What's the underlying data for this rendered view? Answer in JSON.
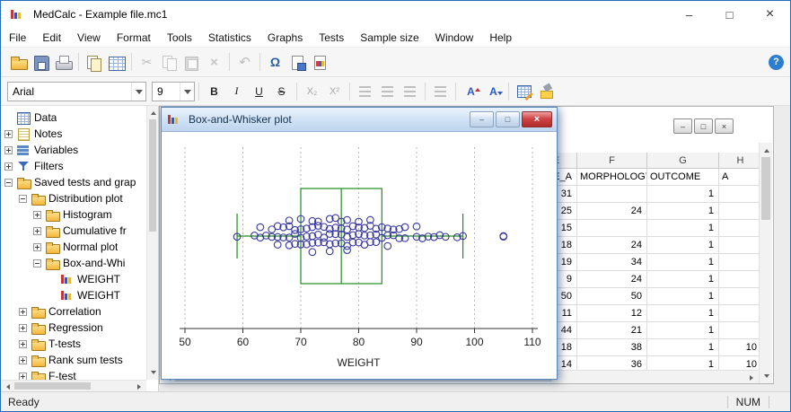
{
  "titlebar": {
    "title": "MedCalc - Example file.mc1",
    "buttons": {
      "minimize": "–",
      "maximize": "□",
      "close": "×"
    }
  },
  "menu": {
    "items": [
      "File",
      "Edit",
      "View",
      "Format",
      "Tools",
      "Statistics",
      "Graphs",
      "Tests",
      "Sample size",
      "Window",
      "Help"
    ]
  },
  "toolbar_main": {
    "icons": [
      "open-folder",
      "save",
      "print",
      "|",
      "copy-page",
      "table",
      "|",
      "cut",
      "copy",
      "paste",
      "delete",
      "|",
      "undo",
      "|",
      "omega",
      "insert-sheet",
      "chart-sheet"
    ],
    "disabled": [
      "cut",
      "copy",
      "paste",
      "delete",
      "undo"
    ],
    "glyphs": {
      "cut": "✂",
      "delete": "×",
      "undo": "↶",
      "omega": "Ω"
    },
    "help_glyph": "?"
  },
  "format_toolbar": {
    "font_name": "Arial",
    "font_size": "9",
    "buttons": [
      "|",
      "bold",
      "italic",
      "underline",
      "strikethrough",
      "|",
      "subscript",
      "superscript",
      "|",
      "align-left",
      "align-center",
      "align-right",
      "|",
      "list",
      "|",
      "font-increase",
      "font-decrease",
      "|",
      "format-cells",
      "highlight"
    ],
    "disabled": [
      "subscript",
      "superscript",
      "align-left",
      "align-center",
      "align-right",
      "list"
    ],
    "glyphs": {
      "bold": "B",
      "italic": "I",
      "underline": "U",
      "strikethrough": "S",
      "subscript": "X₂",
      "superscript": "X²",
      "font-increase": "A",
      "font-decrease": "A"
    }
  },
  "sidebar": {
    "items": [
      {
        "label": "Data",
        "depth": 0,
        "icon": "table",
        "expander": "none"
      },
      {
        "label": "Notes",
        "depth": 0,
        "icon": "notes",
        "expander": "plus"
      },
      {
        "label": "Variables",
        "depth": 0,
        "icon": "variables",
        "expander": "plus"
      },
      {
        "label": "Filters",
        "depth": 0,
        "icon": "filter",
        "expander": "plus"
      },
      {
        "label": "Saved tests and grap",
        "depth": 0,
        "icon": "folder",
        "expander": "minus"
      },
      {
        "label": "Distribution plot",
        "depth": 1,
        "icon": "folder",
        "expander": "minus"
      },
      {
        "label": "Histogram",
        "depth": 2,
        "icon": "folder",
        "expander": "plus"
      },
      {
        "label": "Cumulative fr",
        "depth": 2,
        "icon": "folder",
        "expander": "plus"
      },
      {
        "label": "Normal plot",
        "depth": 2,
        "icon": "folder",
        "expander": "plus"
      },
      {
        "label": "Box-and-Whi",
        "depth": 2,
        "icon": "folder",
        "expander": "minus"
      },
      {
        "label": "WEIGHT",
        "depth": 3,
        "icon": "chart",
        "expander": "none"
      },
      {
        "label": "WEIGHT",
        "depth": 3,
        "icon": "chart",
        "expander": "none"
      },
      {
        "label": "Correlation",
        "depth": 1,
        "icon": "folder",
        "expander": "plus"
      },
      {
        "label": "Regression",
        "depth": 1,
        "icon": "folder",
        "expander": "plus"
      },
      {
        "label": "T-tests",
        "depth": 1,
        "icon": "folder",
        "expander": "plus"
      },
      {
        "label": "Rank sum tests",
        "depth": 1,
        "icon": "folder",
        "expander": "plus"
      },
      {
        "label": "F-test",
        "depth": 1,
        "icon": "folder",
        "expander": "plus"
      }
    ]
  },
  "plot_window": {
    "title": "Box-and-Whisker plot",
    "buttons": {
      "minimize": "–",
      "maximize": "□",
      "close": "×"
    }
  },
  "chart_data": {
    "type": "box-and-whisker",
    "title": "Box-and-Whisker plot",
    "xlabel": "WEIGHT",
    "xlim": [
      50,
      110
    ],
    "xticks": [
      50,
      60,
      70,
      80,
      90,
      100,
      110
    ],
    "grid": "vertical-dashed",
    "box": {
      "lower_whisker": 59,
      "q1": 70,
      "median": 77,
      "q3": 84,
      "upper_whisker": 98
    },
    "outliers": [
      105
    ],
    "points": [
      59,
      62,
      63,
      63,
      64,
      65,
      65,
      66,
      66,
      66,
      67,
      67,
      68,
      68,
      68,
      68,
      69,
      69,
      69,
      70,
      70,
      70,
      70,
      71,
      71,
      71,
      72,
      72,
      72,
      72,
      72,
      73,
      73,
      73,
      73,
      74,
      74,
      74,
      75,
      75,
      75,
      75,
      75,
      76,
      76,
      76,
      76,
      77,
      77,
      77,
      77,
      78,
      78,
      78,
      78,
      78,
      79,
      79,
      79,
      80,
      80,
      80,
      80,
      81,
      81,
      81,
      82,
      82,
      82,
      82,
      83,
      83,
      83,
      84,
      84,
      85,
      85,
      85,
      86,
      86,
      87,
      87,
      88,
      88,
      90,
      90,
      91,
      92,
      93,
      94,
      95,
      97,
      98,
      105
    ]
  },
  "spreadsheet": {
    "buttons": {
      "minimize": "–",
      "restore": "□",
      "close": "×"
    },
    "column_letters": [
      "E",
      "F",
      "G",
      "H"
    ],
    "header_row": [
      "DE_A",
      "MORPHOLOGY",
      "OUTCOME",
      "A"
    ],
    "rows": [
      [
        "31",
        "",
        "1",
        ""
      ],
      [
        "25",
        "24",
        "1",
        ""
      ],
      [
        "15",
        "",
        "1",
        ""
      ],
      [
        "18",
        "24",
        "1",
        ""
      ],
      [
        "19",
        "34",
        "1",
        ""
      ],
      [
        "9",
        "24",
        "1",
        ""
      ],
      [
        "50",
        "50",
        "1",
        ""
      ],
      [
        "11",
        "12",
        "1",
        ""
      ],
      [
        "44",
        "21",
        "1",
        ""
      ],
      [
        "18",
        "38",
        "1",
        "10"
      ],
      [
        "14",
        "36",
        "1",
        "10"
      ]
    ]
  },
  "statusbar": {
    "left": "Ready",
    "right": "NUM"
  },
  "colors": {
    "box_green": "#1e8c1e",
    "point_navy": "#3636a0",
    "close_red": "#c03a3a",
    "help_blue": "#2d7dd2",
    "window_border": "#2a6cb5",
    "gridline": "#b2bab2"
  }
}
